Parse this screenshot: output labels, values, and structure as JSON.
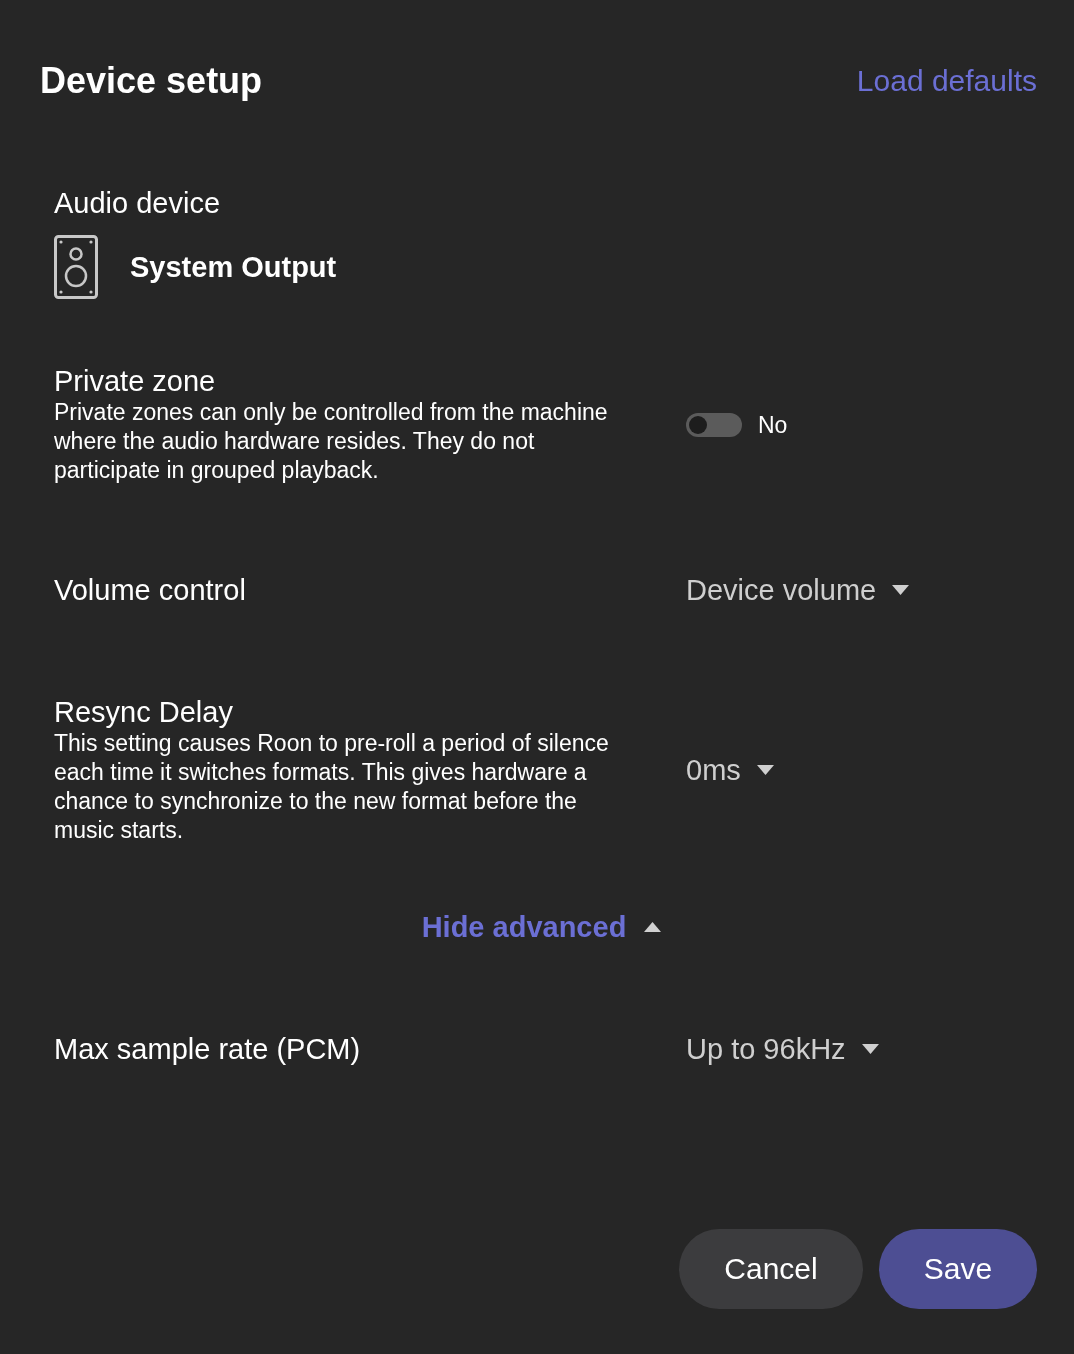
{
  "header": {
    "title": "Device setup",
    "load_defaults": "Load defaults"
  },
  "audio_device": {
    "label": "Audio device",
    "name": "System Output"
  },
  "settings": [
    {
      "kind": "toggle",
      "label": "Private zone",
      "description": "Private zones can only be controlled from the machine where the audio hardware resides. They do not participate in grouped playback.",
      "on": false,
      "value": "No"
    },
    {
      "kind": "dropdown",
      "label": "Volume control",
      "value": "Device volume"
    },
    {
      "kind": "dropdown",
      "label": "Resync Delay",
      "description": "This setting causes Roon to pre-roll a period of silence each time it switches formats. This gives hardware a chance to synchronize to the new format before the music starts.",
      "value": "0ms"
    }
  ],
  "advanced_toggle": {
    "label": "Hide advanced",
    "expanded": true
  },
  "advanced_settings": [
    {
      "kind": "dropdown",
      "label": "Max sample rate (PCM)",
      "value": "Up to 96kHz"
    }
  ],
  "buttons": [
    {
      "kind": "secondary",
      "label": "Cancel"
    },
    {
      "kind": "primary",
      "label": "Save"
    }
  ]
}
